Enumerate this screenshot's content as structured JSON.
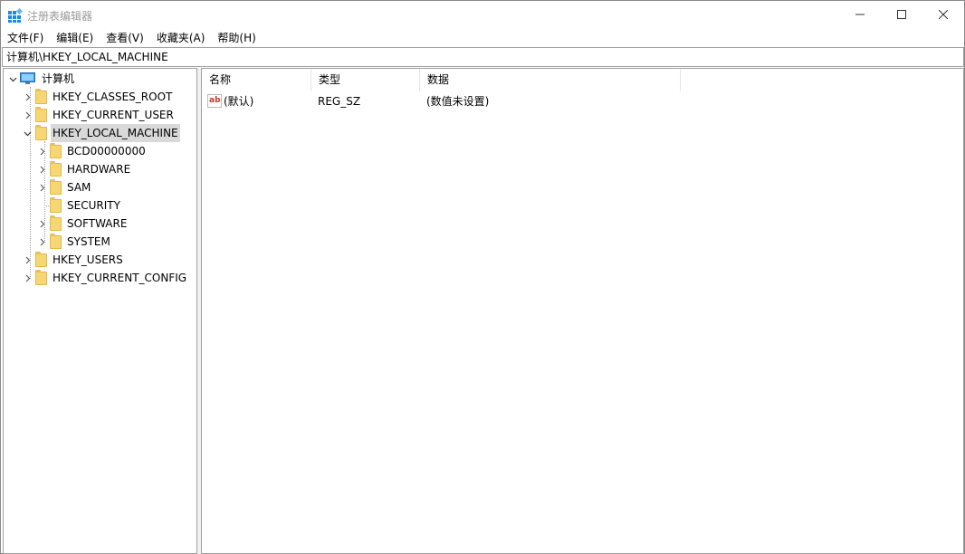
{
  "window": {
    "title": "注册表编辑器"
  },
  "menu": [
    "文件(F)",
    "编辑(E)",
    "查看(V)",
    "收藏夹(A)",
    "帮助(H)"
  ],
  "address": "计算机\\HKEY_LOCAL_MACHINE",
  "tree": {
    "root": "计算机",
    "hives": [
      {
        "label": "HKEY_CLASSES_ROOT",
        "expanded": false
      },
      {
        "label": "HKEY_CURRENT_USER",
        "expanded": false
      },
      {
        "label": "HKEY_LOCAL_MACHINE",
        "expanded": true,
        "selected": true,
        "children": [
          "BCD00000000",
          "HARDWARE",
          "SAM",
          "SECURITY",
          "SOFTWARE",
          "SYSTEM"
        ]
      },
      {
        "label": "HKEY_USERS",
        "expanded": false
      },
      {
        "label": "HKEY_CURRENT_CONFIG",
        "expanded": false
      }
    ]
  },
  "list": {
    "columns": [
      "名称",
      "类型",
      "数据"
    ],
    "rows": [
      {
        "name": "(默认)",
        "type": "REG_SZ",
        "data": "(数值未设置)",
        "icon": "string-value-icon"
      }
    ]
  },
  "colors": {
    "folder": "#f7d774",
    "selection": "#d9d9d9",
    "titleText": "#9a9a9a"
  }
}
